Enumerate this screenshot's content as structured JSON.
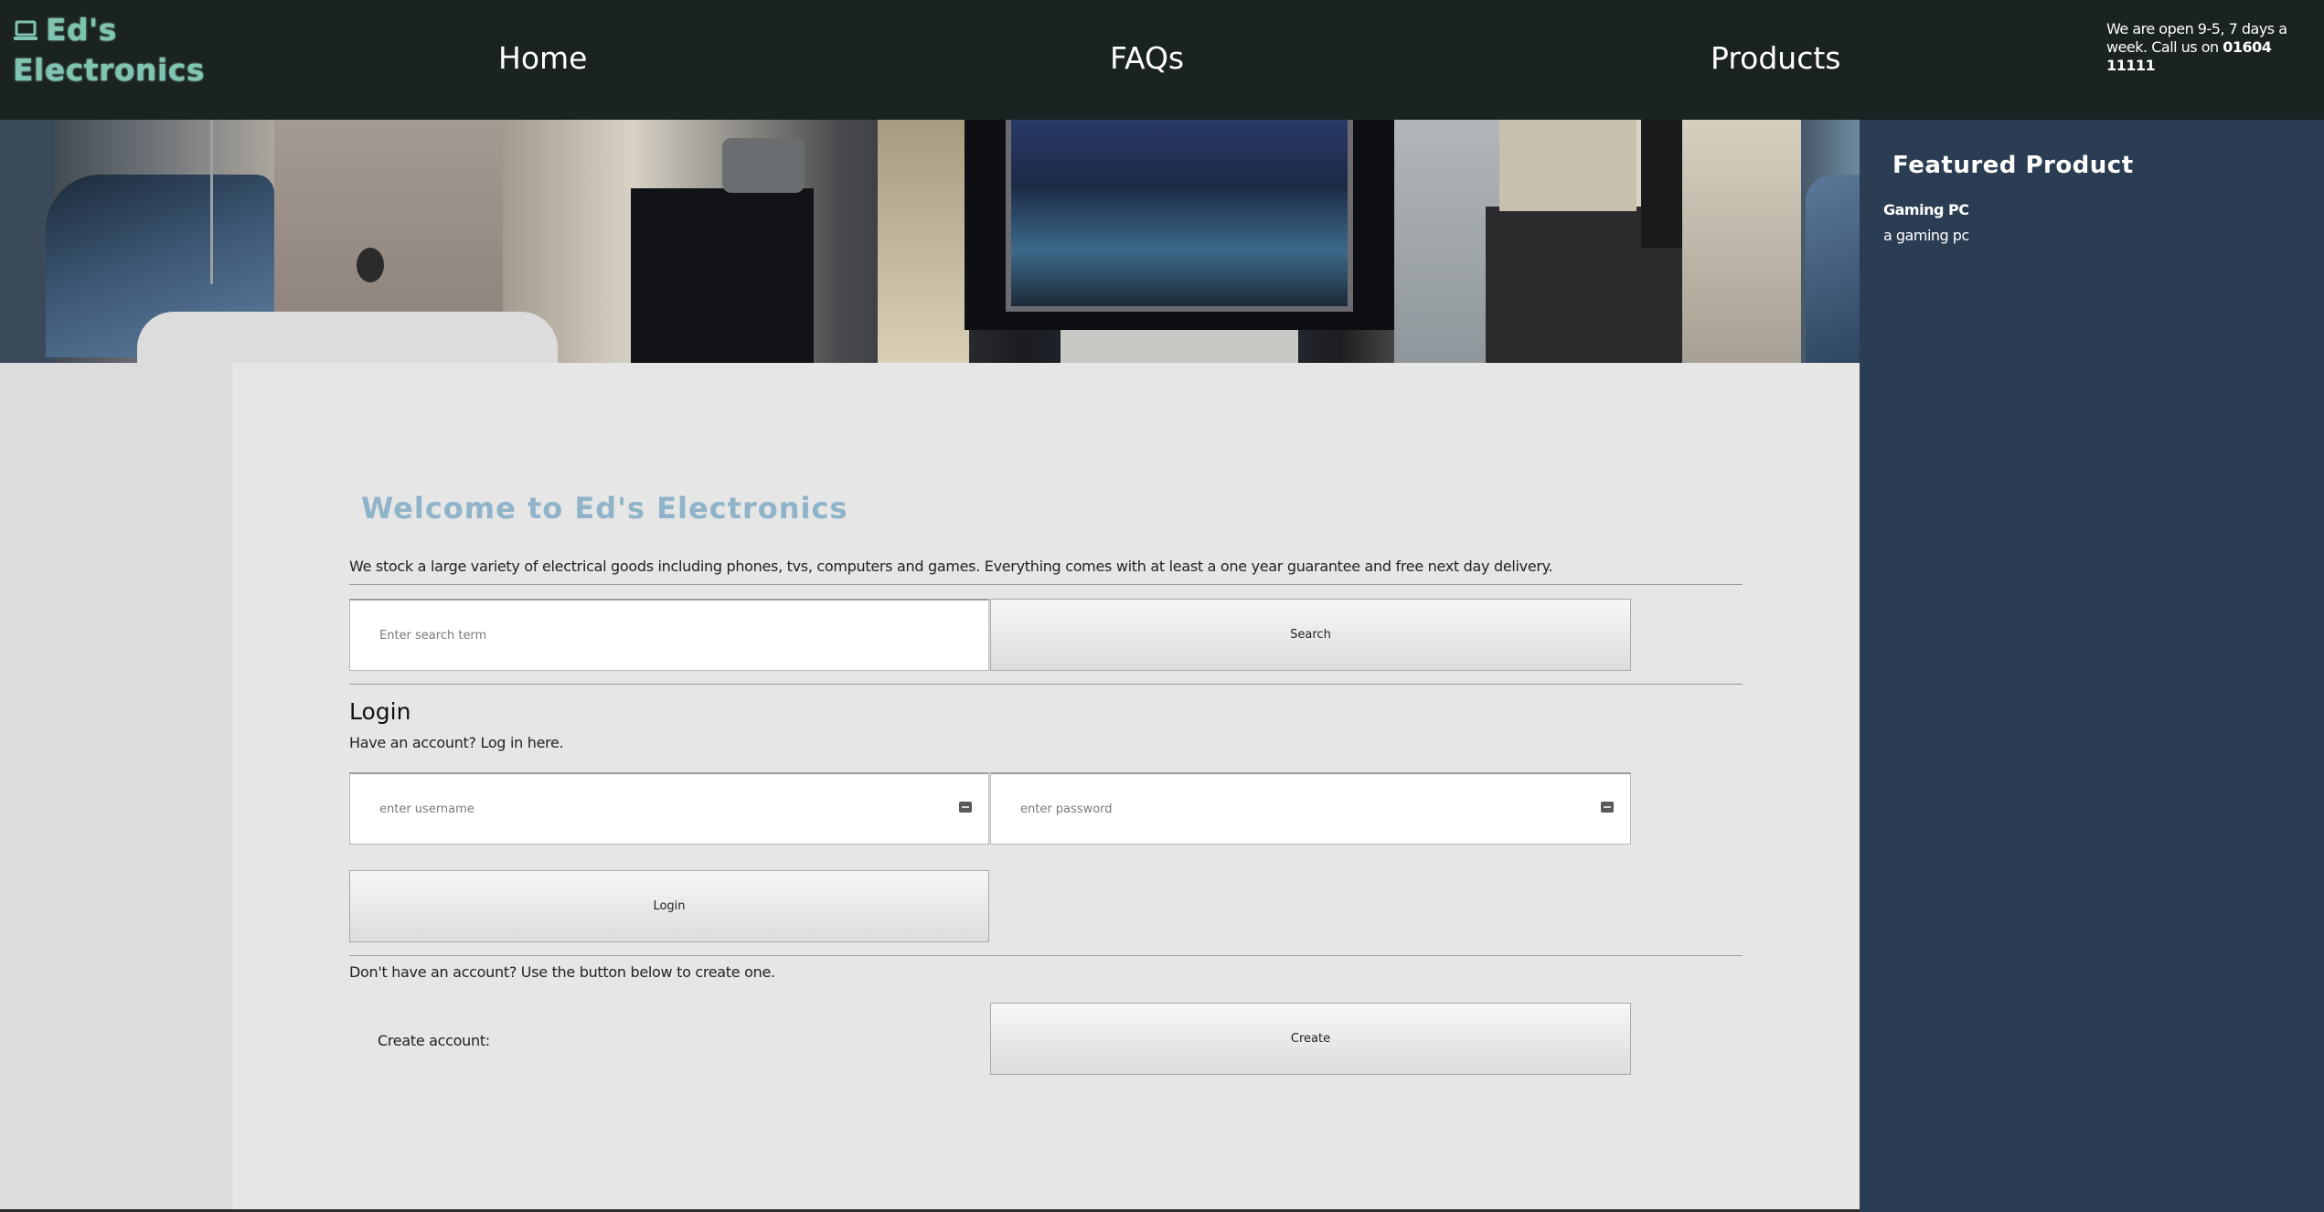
{
  "header": {
    "logo_text": "Ed's Electronics",
    "logo_line1": "Ed's",
    "logo_line2": "Electronics",
    "nav": {
      "home": "Home",
      "faqs": "FAQs",
      "products": "Products"
    },
    "hours_text": "We are open 9-5, 7 days a week. Call us on ",
    "phone": "01604 11111"
  },
  "featured": {
    "title": "Featured Product",
    "product_name": "Gaming PC",
    "product_desc": "a gaming pc"
  },
  "main": {
    "title": "Welcome to Ed's Electronics",
    "intro": "We stock a large variety of electrical goods including phones, tvs, computers and games. Everything comes with at least a one year guarantee and free next day delivery.",
    "search": {
      "placeholder": "Enter search term",
      "button": "Search"
    },
    "login": {
      "heading": "Login",
      "subtext": "Have an account? Log in here.",
      "username_placeholder": "enter username",
      "password_placeholder": "enter password",
      "button": "Login"
    },
    "signup": {
      "text": "Don't have an account? Use the button below to create one.",
      "label": "Create account:",
      "button": "Create"
    }
  },
  "colors": {
    "header_bg": "#1b2222",
    "logo": "#7fc4b0",
    "featured_bg": "#2b3d52",
    "title_accent": "#8fb3c8",
    "main_bg": "#e6e6e6"
  },
  "icons": {
    "logo": "laptop-icon",
    "credential_fields": "key-icon"
  }
}
